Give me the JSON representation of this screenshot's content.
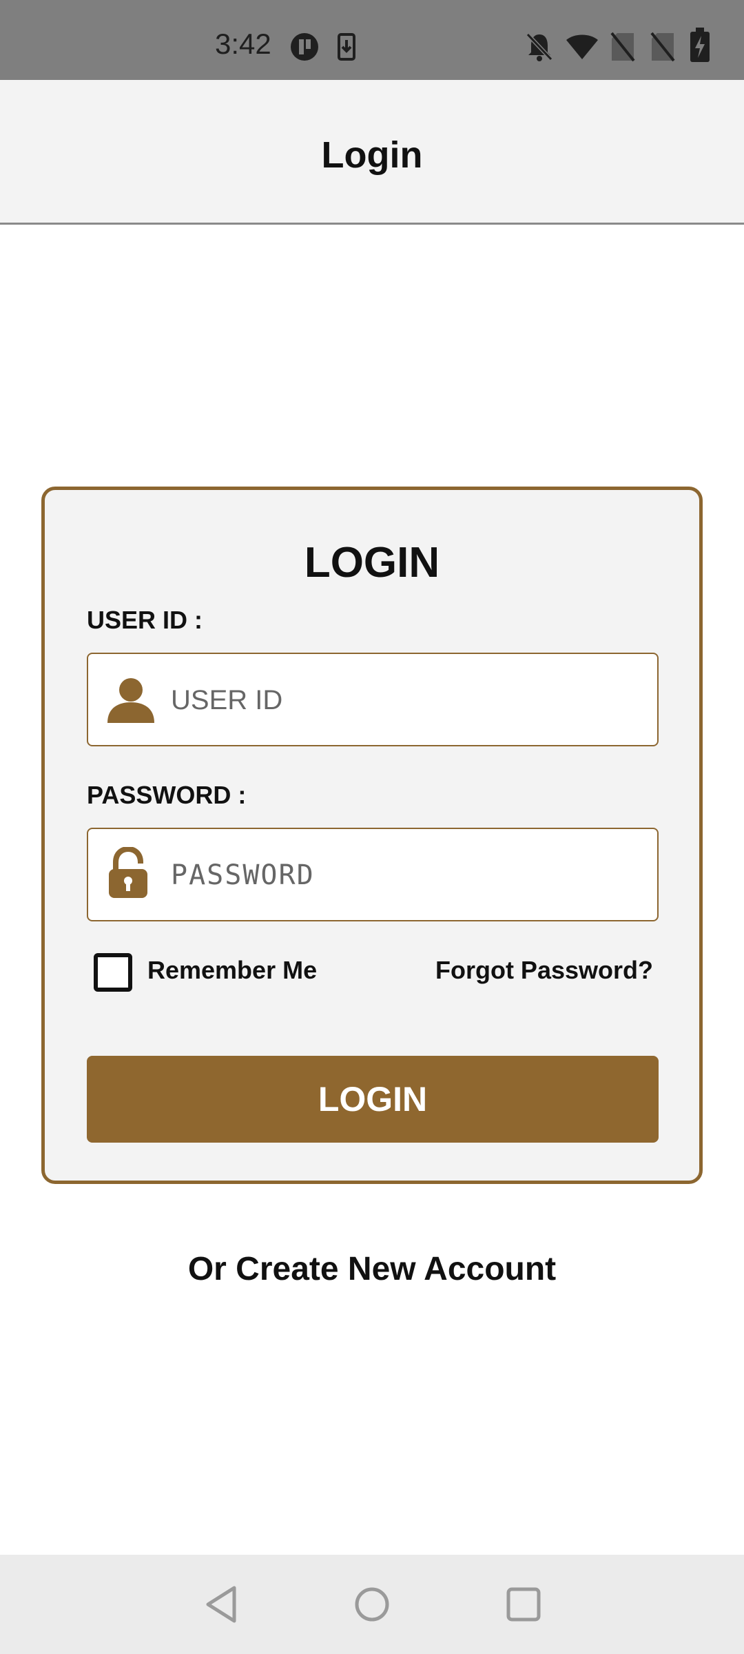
{
  "status_bar": {
    "time": "3:42"
  },
  "app_bar": {
    "title": "Login"
  },
  "card": {
    "title": "LOGIN",
    "user_id": {
      "label": "USER ID :",
      "placeholder": "USER ID",
      "value": ""
    },
    "password": {
      "label": "PASSWORD :",
      "placeholder": "PASSWORD",
      "value": ""
    },
    "remember_me": {
      "label": "Remember Me",
      "checked": false
    },
    "forgot_password": "Forgot Password?",
    "login_button": "LOGIN"
  },
  "create_account": "Or Create New Account",
  "colors": {
    "accent": "#8f672f",
    "status_bar": "#7f7f7f",
    "app_bar": "#f3f3f3",
    "nav_bar": "#ebebeb"
  },
  "icons": {
    "user_field": "person-icon",
    "password_field": "unlock-icon",
    "status": [
      "t-app-icon",
      "download-icon",
      "bell-off-icon",
      "wifi-icon",
      "no-sim-icon",
      "no-sim-icon",
      "battery-charging-icon"
    ],
    "nav": [
      "back-icon",
      "home-icon",
      "recents-icon"
    ]
  }
}
